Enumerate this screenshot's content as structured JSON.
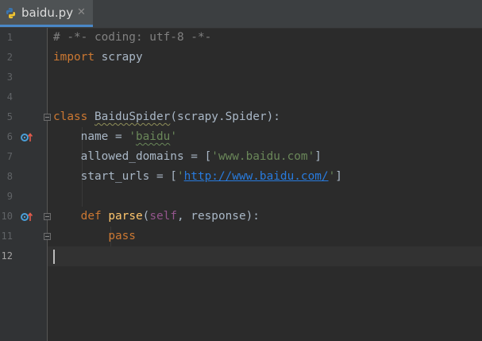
{
  "tab": {
    "filename": "baidu.py",
    "close_glyph": "✕",
    "icon": "python-file-icon"
  },
  "gutter": {
    "line_numbers": [
      "1",
      "2",
      "3",
      "4",
      "5",
      "6",
      "7",
      "8",
      "9",
      "10",
      "11",
      "12"
    ],
    "current_line": "12",
    "override_markers": [
      "6",
      "10"
    ]
  },
  "code": {
    "l1": "# -*- coding: utf-8 -*-",
    "l2_kw": "import",
    "l2_rest": " scrapy",
    "l5_kw": "class",
    "l5_name": "BaiduSpider",
    "l5_rest": "(scrapy.Spider):",
    "l6_lhs": "name = ",
    "l6_q1": "'",
    "l6_str": "baidu",
    "l6_q2": "'",
    "l7_lhs": "allowed_domains = [",
    "l7_str": "'www.baidu.com'",
    "l7_end": "]",
    "l8_lhs": "start_urls = [",
    "l8_q1": "'",
    "l8_link": "http://www.baidu.com/",
    "l8_q2": "'",
    "l8_end": "]",
    "l10_kw": "def",
    "l10_name": "parse",
    "l10_open": "(",
    "l10_self": "self",
    "l10_rest": ", response):",
    "l11_kw": "pass"
  },
  "colors": {
    "background": "#2b2b2b",
    "keyword": "#cc7832",
    "string": "#6a8759",
    "comment": "#808080",
    "function": "#ffc66d",
    "self": "#94558d",
    "link": "#287bde",
    "text": "#a9b7c6"
  }
}
